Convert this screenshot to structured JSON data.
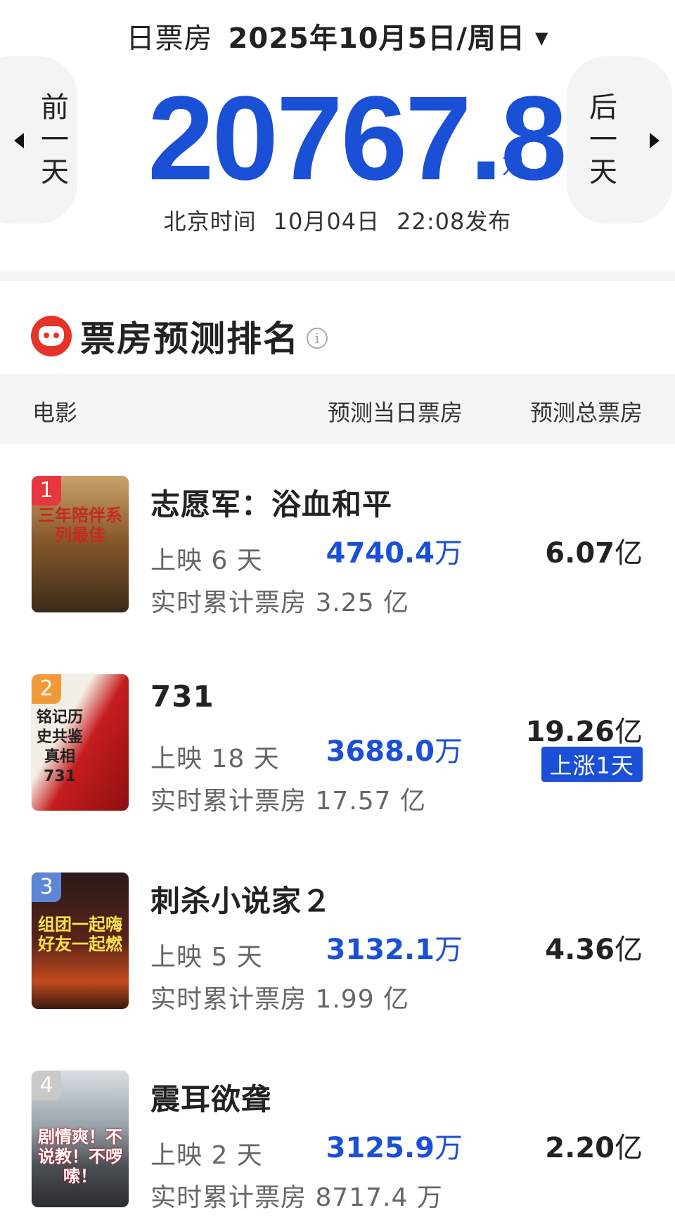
{
  "header": {
    "label": "日票房",
    "date": "2025年10月5日/周日",
    "caret": "▼"
  },
  "nav": {
    "prev_label": "前一天",
    "next_label": "后一天"
  },
  "total": {
    "value": "20767.8",
    "unit": "万"
  },
  "publish": {
    "zone": "北京时间",
    "date": "10月04日",
    "time": "22:08发布"
  },
  "section": {
    "title": "票房预测排名",
    "info_icon": "i"
  },
  "columns": {
    "movie": "电影",
    "pred_day": "预测当日票房",
    "pred_total": "预测总票房"
  },
  "movies": [
    {
      "rank": "1",
      "rank_color": "#e8363f",
      "poster_text": "三年陪伴系列最佳",
      "title": "志愿军：浴血和平",
      "days": "上映 6 天",
      "cumulative": "实时累计票房 3.25 亿",
      "pred_day_value": "4740.4",
      "pred_day_unit": "万",
      "pred_total_value": "6.07",
      "pred_total_unit": "亿",
      "badge": ""
    },
    {
      "rank": "2",
      "rank_color": "#f29a3a",
      "poster_text": "铭记历史共鉴真相731",
      "title": "731",
      "days": "上映 18 天",
      "cumulative": "实时累计票房 17.57 亿",
      "pred_day_value": "3688.0",
      "pred_day_unit": "万",
      "pred_total_value": "19.26",
      "pred_total_unit": "亿",
      "badge": "上涨1天"
    },
    {
      "rank": "3",
      "rank_color": "#5d87d6",
      "poster_text": "组团一起嗨 好友一起燃",
      "title": "刺杀小说家２",
      "days": "上映 5 天",
      "cumulative": "实时累计票房 1.99 亿",
      "pred_day_value": "3132.1",
      "pred_day_unit": "万",
      "pred_total_value": "4.36",
      "pred_total_unit": "亿",
      "badge": ""
    },
    {
      "rank": "4",
      "rank_color": "#c9c9c9",
      "poster_text": "剧情爽！不说教！不啰嗦！",
      "title": "震耳欲聋",
      "days": "上映 2 天",
      "cumulative": "实时累计票房 8717.4 万",
      "pred_day_value": "3125.9",
      "pred_day_unit": "万",
      "pred_total_value": "2.20",
      "pred_total_unit": "亿",
      "badge": ""
    }
  ]
}
